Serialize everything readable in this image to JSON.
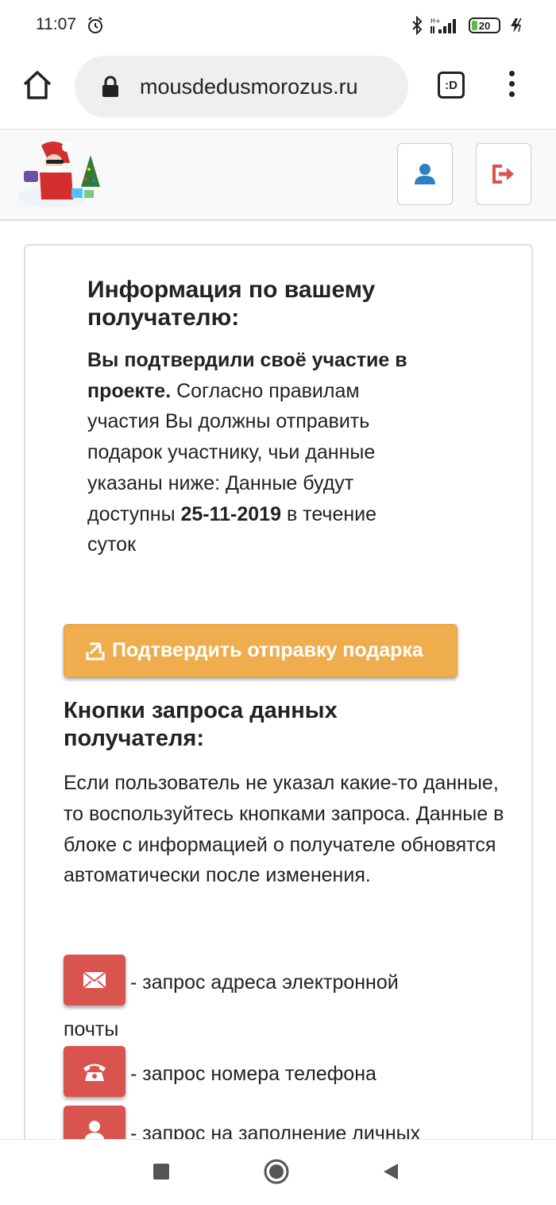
{
  "status": {
    "time": "11:07",
    "battery": "20"
  },
  "browser": {
    "url": "mousdedusmorozus.ru",
    "tab_count": ":D"
  },
  "info": {
    "title": "Информация по вашему получателю:",
    "confirmed_bold": "Вы подтвердили своё участие в проекте.",
    "rules_text": "Согласно правилам участия Вы должны отправить подарок участнику, чьи данные указаны ниже:",
    "available_prefix": "Данные будут доступны ",
    "available_date": "25-11-2019",
    "available_suffix": " в течение суток"
  },
  "confirm_button": {
    "label": "Подтвердить отправку подарка"
  },
  "request": {
    "title": "Кнопки запроса данных получателя:",
    "description": "Если пользователь не указал какие-то данные, то воспользуйтесь кнопками запроса. Данные в блоке с информацией о получателе обновятся автоматически после изменения.",
    "items": [
      {
        "icon": "envelope-icon",
        "text": "- запрос адреса электронной",
        "text_cont": "почты"
      },
      {
        "icon": "phone-icon",
        "text": "- запрос номера телефона"
      },
      {
        "icon": "user-icon",
        "text": "- запрос на заполнение личных"
      }
    ]
  },
  "colors": {
    "confirm": "#f0ad4e",
    "request": "#d9534f",
    "user_icon": "#2f7fc1",
    "logout_icon": "#d9534f"
  }
}
